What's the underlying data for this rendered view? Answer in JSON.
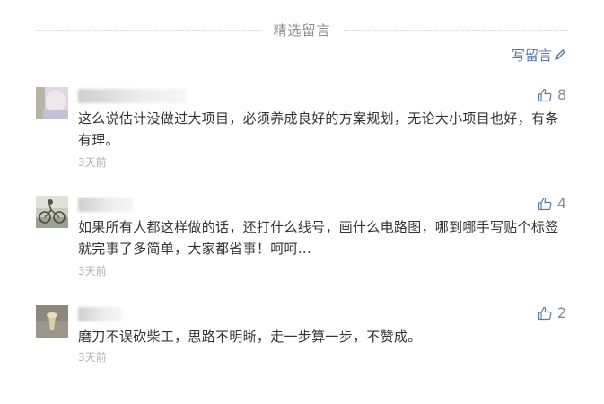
{
  "section": {
    "title": "精选留言",
    "write_label": "写留言"
  },
  "comments": [
    {
      "likes": "8",
      "content": "这么说估计没做过大项目，必须养成良好的方案规划，无论大小项目也好，有条有理。",
      "time": "3天前"
    },
    {
      "likes": "4",
      "content": "如果所有人都这样做的话，还打什么线号，画什么电路图，哪到哪手写贴个标签就完事了多简单，大家都省事！呵呵...",
      "time": "3天前"
    },
    {
      "likes": "2",
      "content": "磨刀不误砍柴工，思路不明晰，走一步算一步，不赞成。",
      "time": "3天前"
    }
  ],
  "colors": {
    "link": "#5a7aa8",
    "muted": "#8c8c8c",
    "time": "#b2b2b2",
    "text": "#333333"
  },
  "icons": {
    "like": "thumbs-up-icon",
    "write": "pencil-icon"
  }
}
